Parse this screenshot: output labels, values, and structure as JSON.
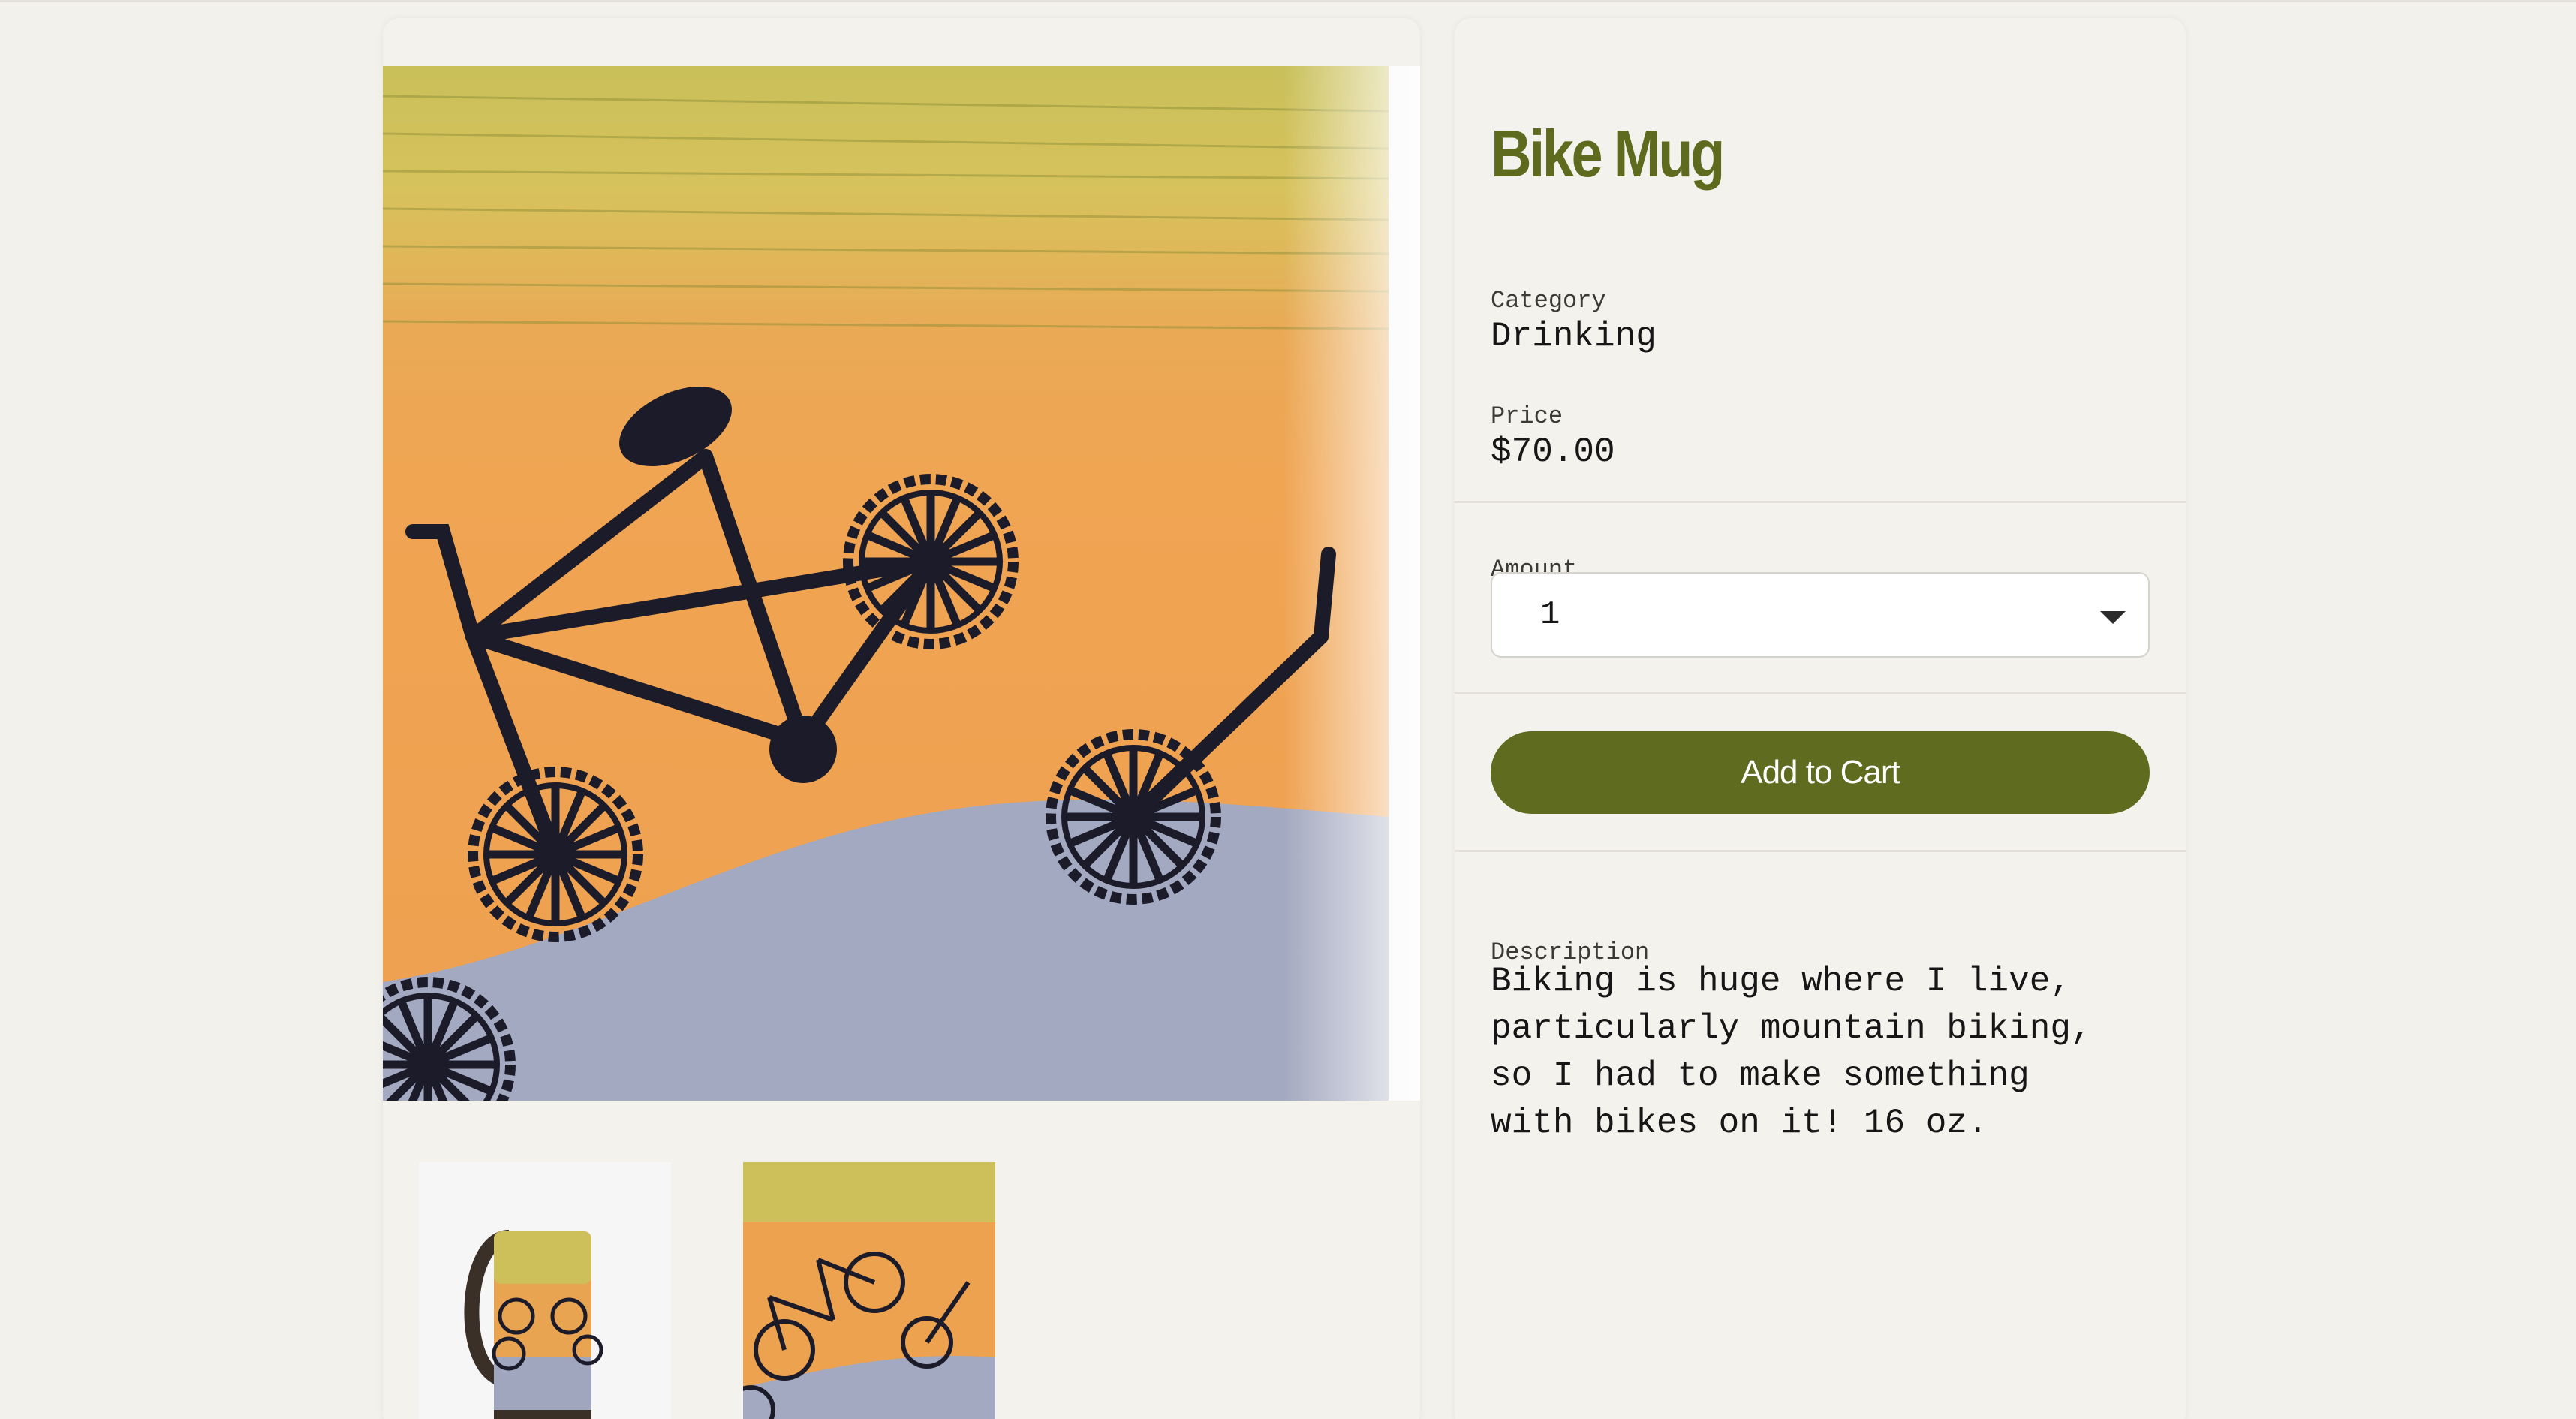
{
  "gallery": {
    "main_image_alt": "Bike mug close-up",
    "thumbnails": [
      "Bike mug with handle",
      "Bike mug pattern close-up"
    ]
  },
  "product": {
    "title": "Bike Mug",
    "category_label": "Category",
    "category_value": "Drinking",
    "price_label": "Price",
    "price_value": "$70.00",
    "amount_label": "Amount",
    "amount_value": "1",
    "add_to_cart_label": "Add to Cart",
    "description_label": "Description",
    "description_text": "Biking is huge where I live,\nparticularly mountain biking,\nso I had to make something\nwith bikes on it! 16 oz."
  },
  "colors": {
    "accent": "#5f6c20",
    "title": "#5e6b1f",
    "background": "#f3f1eb"
  }
}
